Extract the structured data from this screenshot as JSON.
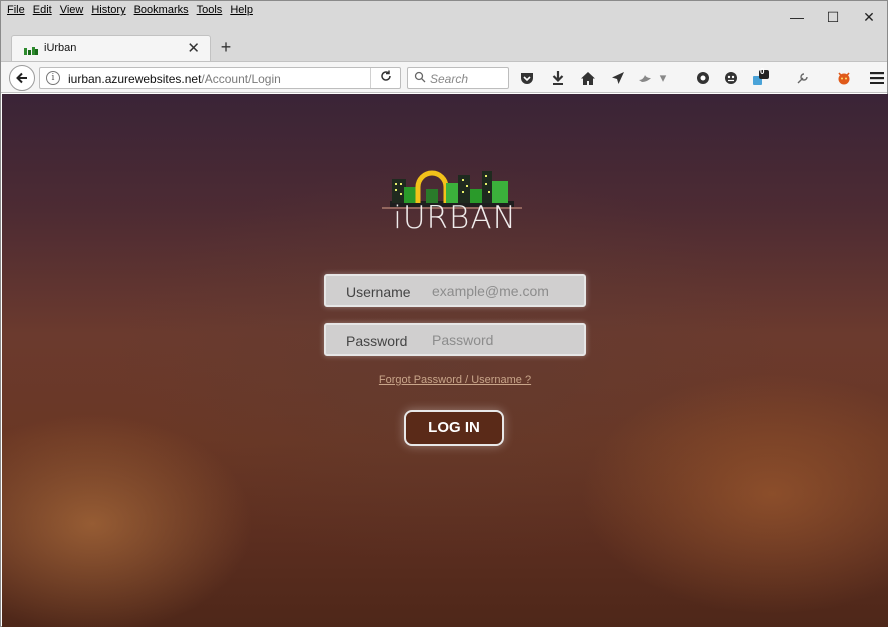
{
  "menu": {
    "items": [
      "File",
      "Edit",
      "View",
      "History",
      "Bookmarks",
      "Tools",
      "Help"
    ]
  },
  "window_controls": {
    "minimize": "—",
    "maximize": "☐",
    "close": "✕"
  },
  "tab": {
    "title": "iUrban",
    "close": "✕",
    "new_tab": "+"
  },
  "navbar": {
    "url_host": "iurban.azurewebsites.net",
    "url_path": "/Account/Login",
    "reload": "C",
    "search_placeholder": "Search",
    "badge_count": "0"
  },
  "page": {
    "brand": "iURBAN",
    "username_label": "Username",
    "username_placeholder": "example@me.com",
    "password_label": "Password",
    "password_placeholder": "Password",
    "forgot_link": "Forgot Password / Username ?",
    "login_button": "LOG IN"
  },
  "colors": {
    "bg_top": "#3a2437",
    "bg_bottom": "#4e2719",
    "field_bg": "#d0cfcf",
    "link": "#c9a58a",
    "button_bg": "#5a2a18"
  }
}
